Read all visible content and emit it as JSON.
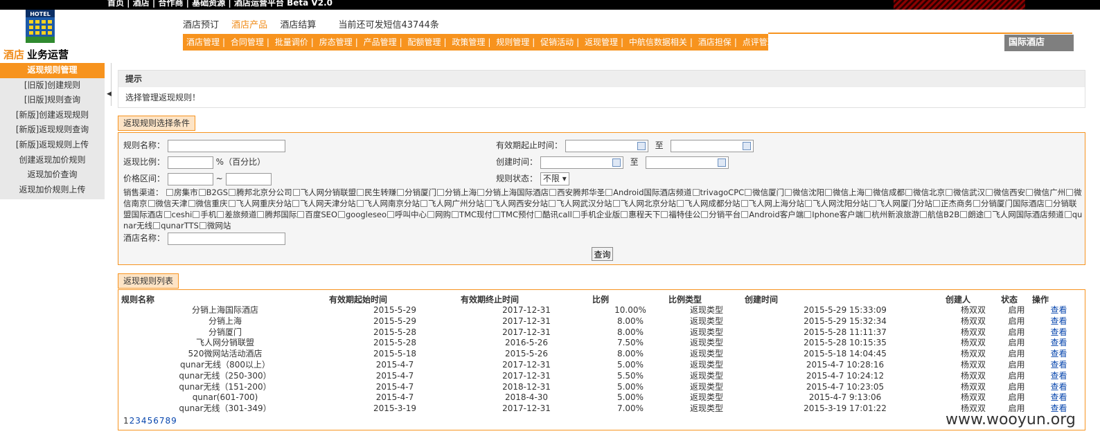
{
  "top_links": "首页 | 酒店 | 合作商 | 基础资源 | 酒店运营平台 Beta V2.0",
  "logo_text": "HOTEL",
  "brand": {
    "highlight": "酒店",
    "rest": "业务运营"
  },
  "modules": {
    "items": [
      "酒店预订",
      "酒店产品",
      "酒店结算"
    ],
    "active_index": 1,
    "sms": "当前还可发短信43744条"
  },
  "menu": [
    "酒店管理",
    "合同管理",
    "批量调价",
    "房态管理",
    "产品管理",
    "配额管理",
    "政策管理",
    "规则管理",
    "促销活动",
    "返现管理",
    "中航信数据相关",
    "酒店担保",
    "点评管理"
  ],
  "intl_label": "国际酒店",
  "sidebar": {
    "title": "返现规则管理",
    "items": [
      "[旧版]创建规则",
      "[旧版]规则查询",
      "[新版]创建返现规则",
      "[新版]返现规则查询",
      "[新版]返现规则上传",
      "创建返现加价规则",
      "返现加价查询",
      "返现加价规则上传"
    ]
  },
  "tip": {
    "title": "提示",
    "body": "选择管理返现规则！"
  },
  "filter": {
    "tab": "返现规则选择条件",
    "rule_name_label": "规则名称：",
    "ratio_label": "返现比例：",
    "ratio_suffix": "%（百分比）",
    "price_label": "价格区间：",
    "price_sep": "~",
    "valid_label": "有效期起止时间：",
    "to": "至",
    "created_label": "创建时间：",
    "status_label": "规则状态：",
    "status_value": "不限",
    "channel_label": "销售渠道：",
    "channels": [
      "房集市",
      "B2GS",
      "腾邦北京分公司",
      "飞人网分销联盟",
      "民生转赚",
      "分销厦门",
      "分销上海",
      "分销上海国际酒店",
      "西安腾邦华圣",
      "Android国际酒店频道",
      "trivagoCPC",
      "微信厦门",
      "微信沈阳",
      "微信上海",
      "微信成都",
      "微信北京",
      "微信武汉",
      "微信西安",
      "微信广州",
      "微信南京",
      "微信天津",
      "微信重庆",
      "飞人网重庆分站",
      "飞人网天津分站",
      "飞人网南京分站",
      "飞人网广州分站",
      "飞人网西安分站",
      "飞人网武汉分站",
      "飞人网北京分站",
      "飞人网成都分站",
      "飞人网上海分站",
      "飞人网沈阳分站",
      "飞人网厦门分站",
      "正杰商务",
      "分销厦门国际酒店",
      "分销联盟国际酒店",
      "ceshi",
      "手机",
      "差旅频道",
      "腾邦国际",
      "百度SEO",
      "googleseo",
      "呼叫中心",
      "网购",
      "TMC现付",
      "TMC预付",
      "酷讯call",
      "手机企业版",
      "惠程天下",
      "福特佳公",
      "分销平台",
      "Android客户端",
      "Iphone客户端",
      "杭州新浪旅游",
      "航信B2B",
      "朗途",
      "飞人网国际酒店频道",
      "qunar无线",
      "qunarTTS",
      "微网站"
    ],
    "hotel_name_label": "酒店名称：",
    "query_button": "查询"
  },
  "list": {
    "tab": "返现规则列表",
    "headers": [
      "规则名称",
      "有效期起始时间",
      "有效期终止时间",
      "比例",
      "比例类型",
      "创建时间",
      "创建人",
      "状态",
      "操作"
    ],
    "rows": [
      [
        "分销上海国际酒店",
        "2015-5-29",
        "2017-12-31",
        "10.00%",
        "返现类型",
        "2015-5-29 15:33:09",
        "杨双双",
        "启用",
        "查看"
      ],
      [
        "分销上海",
        "2015-5-29",
        "2017-12-31",
        "8.00%",
        "返现类型",
        "2015-5-29 15:32:34",
        "杨双双",
        "启用",
        "查看"
      ],
      [
        "分销厦门",
        "2015-5-28",
        "2017-12-31",
        "8.00%",
        "返现类型",
        "2015-5-28 11:11:37",
        "杨双双",
        "启用",
        "查看"
      ],
      [
        "飞人网分销联盟",
        "2015-5-28",
        "2016-5-26",
        "7.50%",
        "返现类型",
        "2015-5-28 10:15:35",
        "杨双双",
        "启用",
        "查看"
      ],
      [
        "520微网站活动酒店",
        "2015-5-18",
        "2015-5-26",
        "8.00%",
        "返现类型",
        "2015-5-18 14:04:45",
        "杨双双",
        "启用",
        "查看"
      ],
      [
        "qunar无线（800以上）",
        "2015-4-7",
        "2017-12-31",
        "5.00%",
        "返现类型",
        "2015-4-7 10:28:16",
        "杨双双",
        "启用",
        "查看"
      ],
      [
        "qunar无线（250-300）",
        "2015-4-7",
        "2017-12-31",
        "5.50%",
        "返现类型",
        "2015-4-7 10:24:12",
        "杨双双",
        "启用",
        "查看"
      ],
      [
        "qunar无线（151-200）",
        "2015-4-7",
        "2018-12-31",
        "5.00%",
        "返现类型",
        "2015-4-7 10:23:05",
        "杨双双",
        "启用",
        "查看"
      ],
      [
        "qunar(601-700)",
        "2015-4-7",
        "2018-4-30",
        "5.00%",
        "返现类型",
        "2015-4-7 9:13:06",
        "杨双双",
        "启用",
        "查看"
      ],
      [
        "qunar无线（301-349）",
        "2015-3-19",
        "2017-12-31",
        "7.00%",
        "返现类型",
        "2015-3-19 17:01:22",
        "杨双双",
        "启用",
        "查看"
      ]
    ],
    "pages": [
      "1",
      "2",
      "3",
      "4",
      "5",
      "6",
      "7",
      "8",
      "9"
    ]
  },
  "watermark": "www.wooyun.org"
}
